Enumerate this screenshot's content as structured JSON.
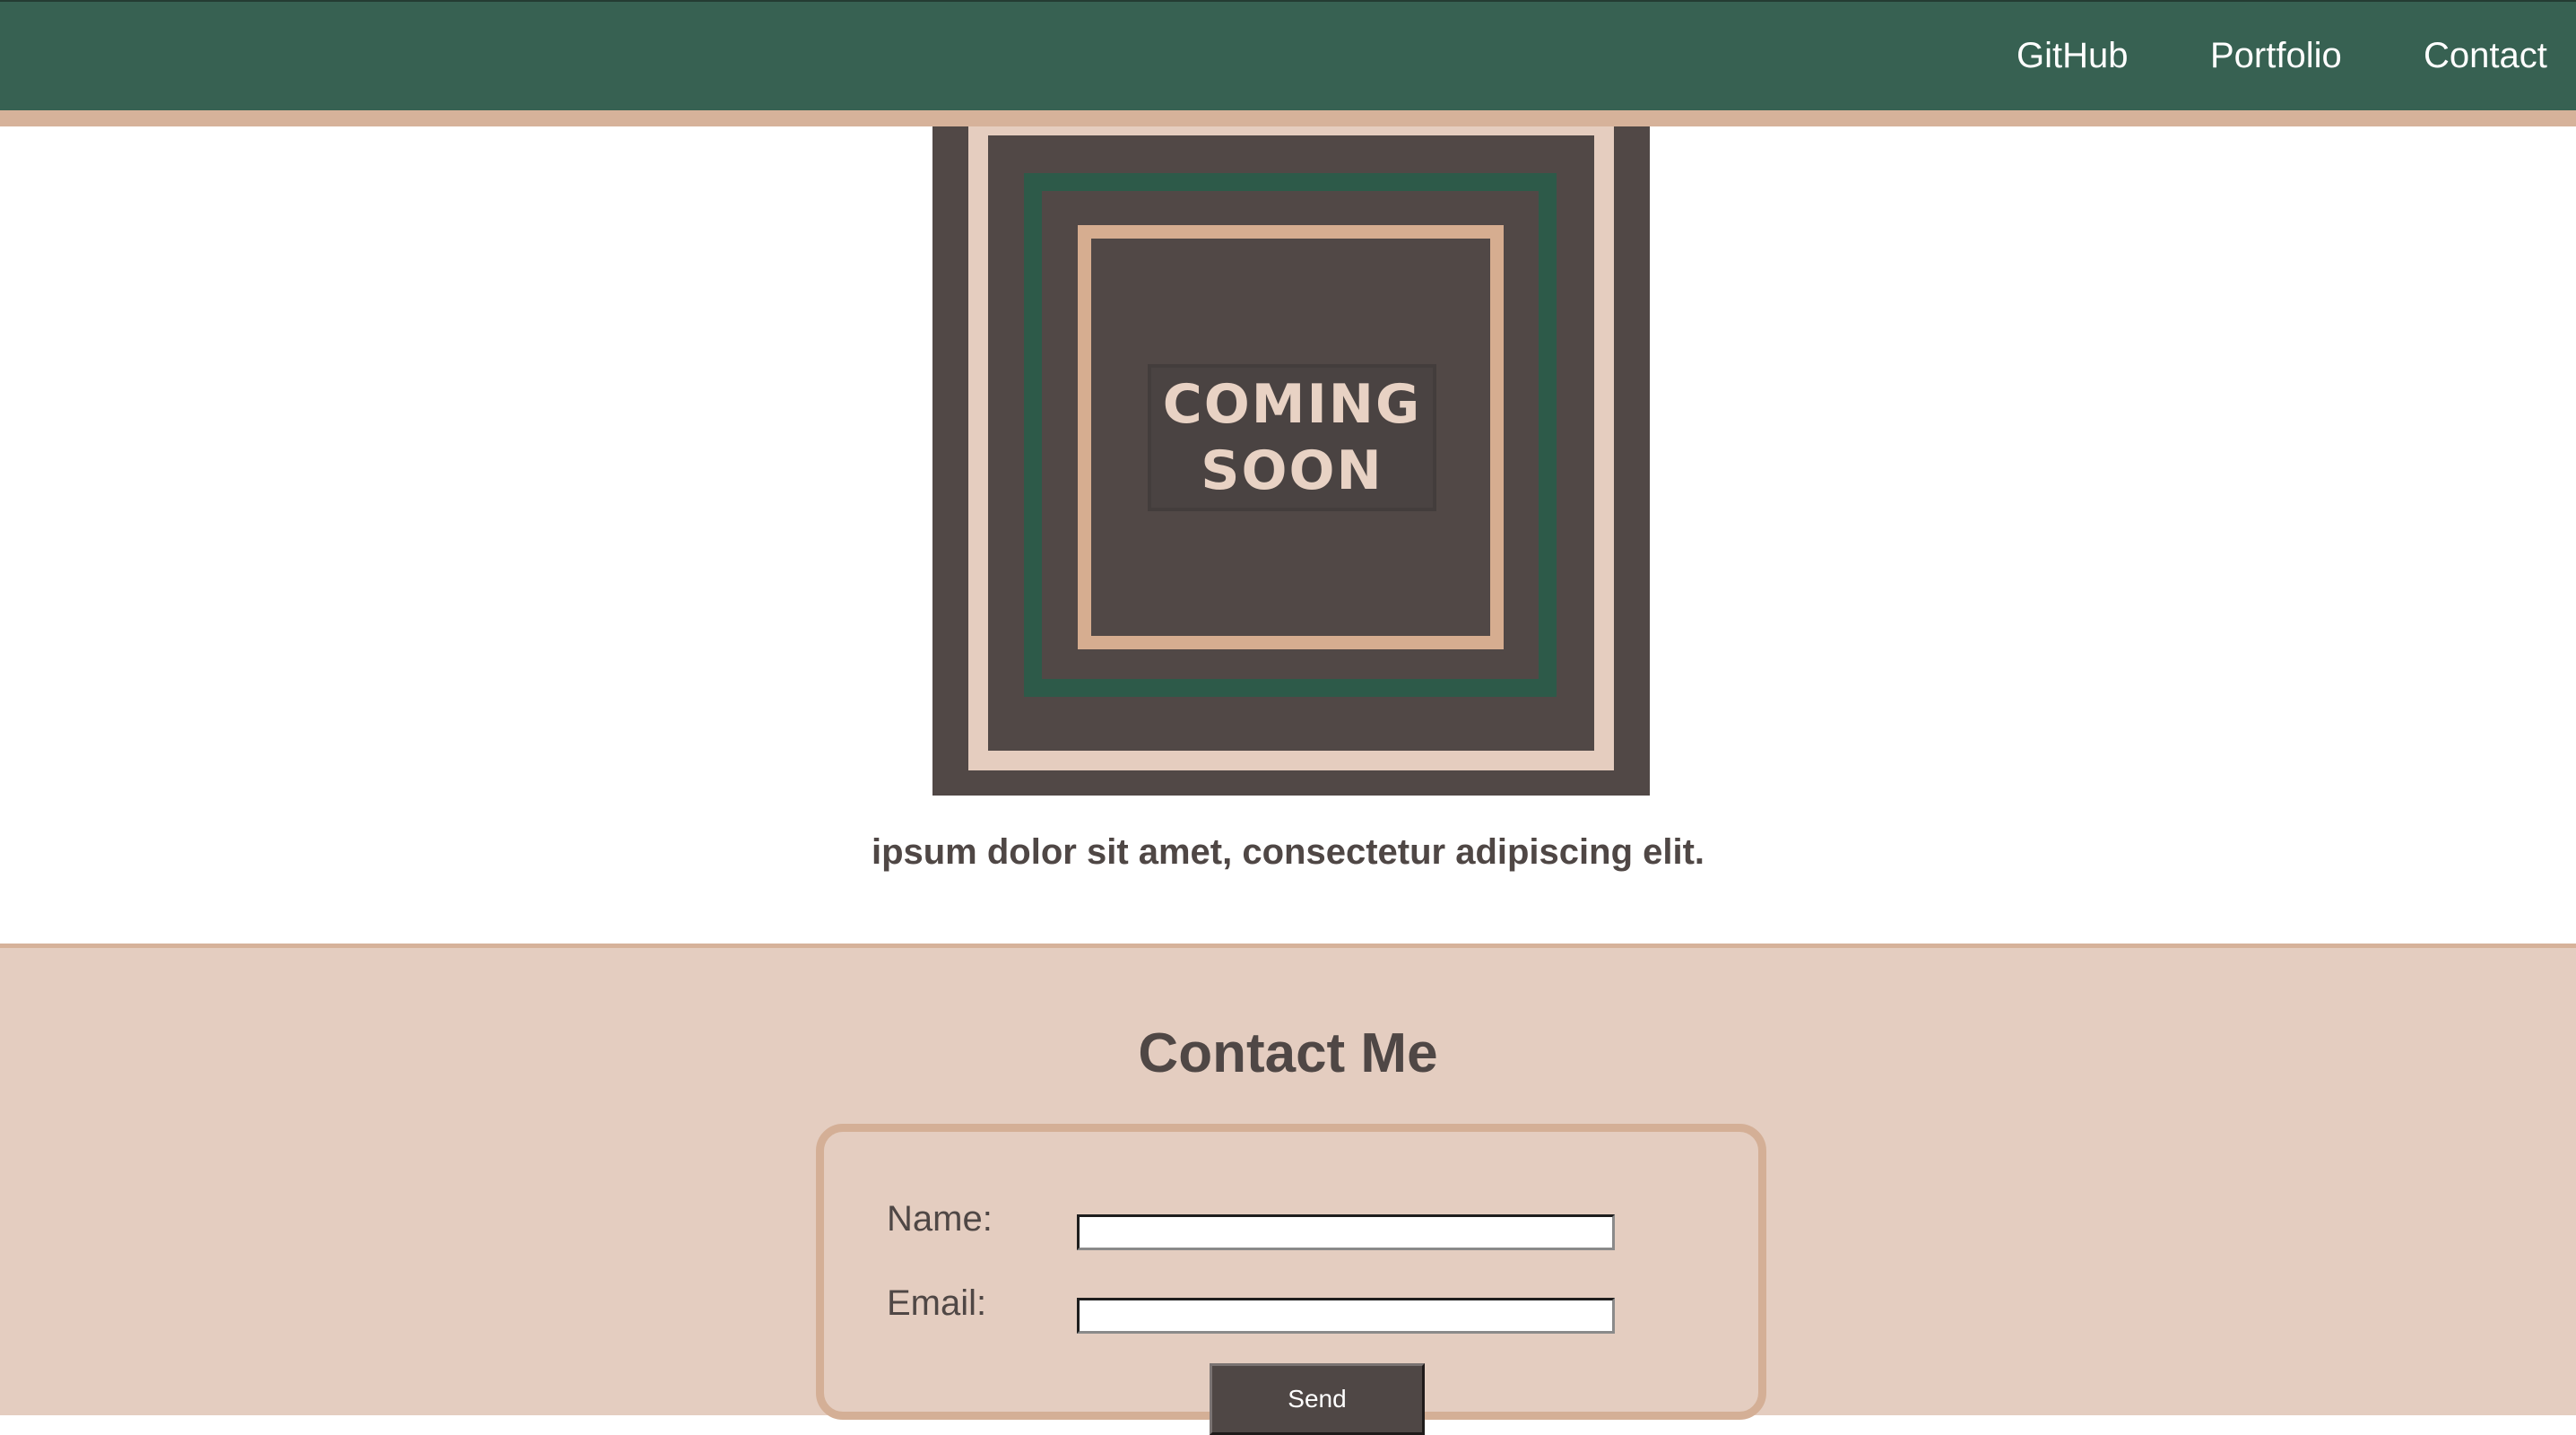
{
  "nav": {
    "links": [
      "GitHub",
      "Portfolio",
      "Contact"
    ]
  },
  "hero": {
    "image_text": "COMING\nSOON",
    "caption": "ipsum dolor sit amet, consectetur adipiscing elit."
  },
  "contact": {
    "title": "Contact Me",
    "name_label": "Name:",
    "name_value": "",
    "email_label": "Email:",
    "email_value": "",
    "send_label": "Send"
  },
  "colors": {
    "header": "#376152",
    "accent_strip": "#d6b29a",
    "contact_background": "#e4cdc0",
    "text": "#4f4745",
    "button": "#4f4745"
  }
}
